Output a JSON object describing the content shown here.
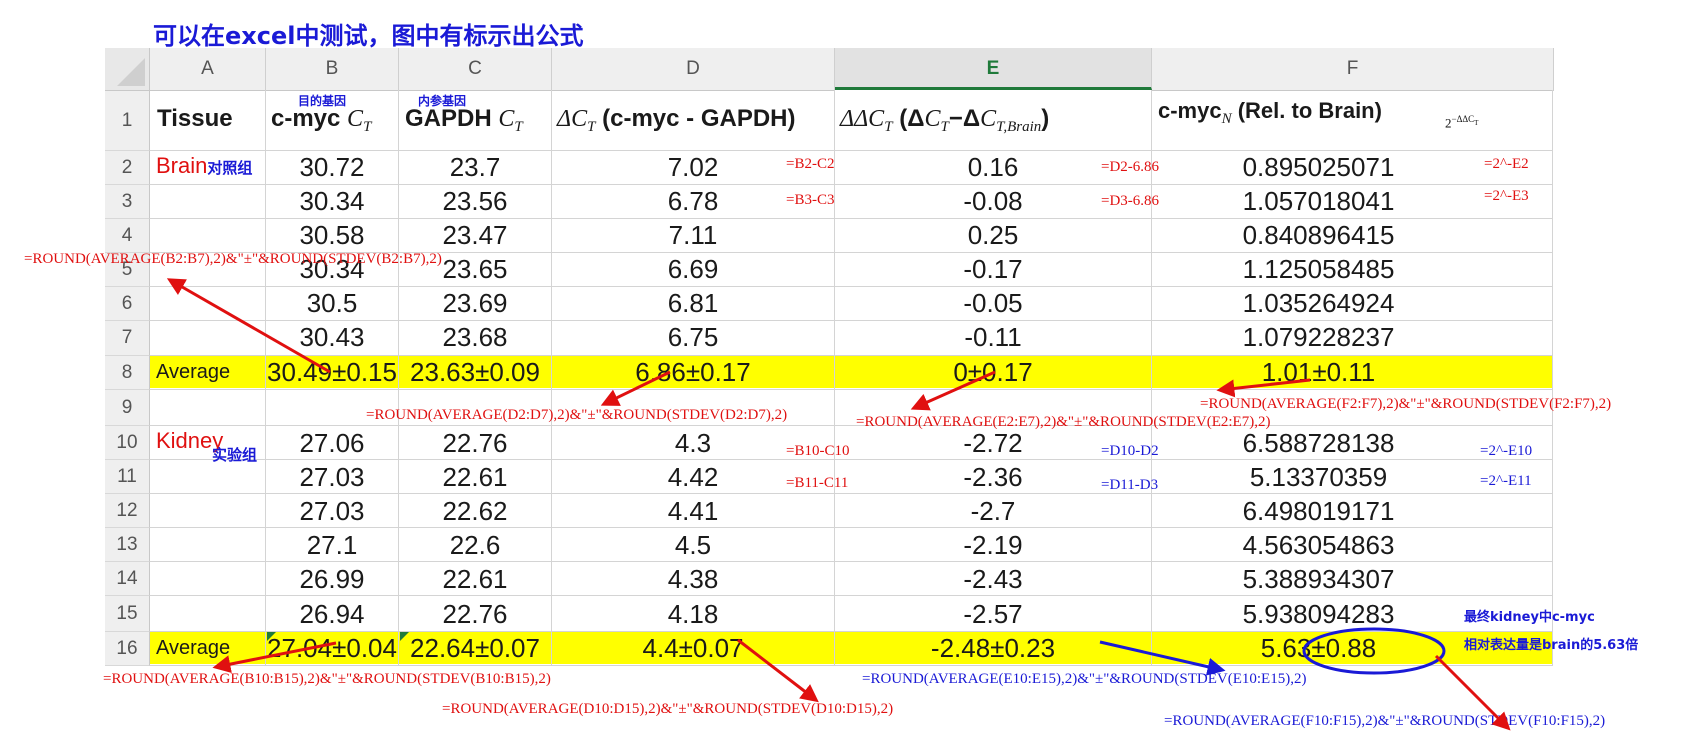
{
  "title": "可以在excel中测试，图中有标示出公式",
  "columns": [
    "A",
    "B",
    "C",
    "D",
    "E",
    "F"
  ],
  "active_column": "E",
  "row_numbers": [
    "1",
    "2",
    "3",
    "4",
    "5",
    "6",
    "7",
    "8",
    "9",
    "10",
    "11",
    "12",
    "13",
    "14",
    "15",
    "16"
  ],
  "header_tags": {
    "B": "目的基因",
    "C": "内参基因"
  },
  "headers": {
    "A": "Tissue",
    "B_pre": "c-myc ",
    "B_it": "C",
    "B_sub": "T",
    "C_pre": "GAPDH ",
    "C_it": "C",
    "C_sub": "T",
    "D_delta": "Δ",
    "D_it": "C",
    "D_sub": "T",
    "D_post": " (c-myc - GAPDH)",
    "E_delta": "ΔΔ",
    "E_it": "C",
    "E_sub": "T",
    "E_post1": " (Δ",
    "E_it2": "C",
    "E_sub2": "T",
    "E_mid": "−Δ",
    "E_it3": "C",
    "E_sub3": "T,Brain",
    "E_post2": ")",
    "F_pre": "c-myc",
    "F_sub": "N",
    "F_post": " (Rel. to Brain)",
    "F_note": "2",
    "F_note_exp": "−ΔΔC",
    "F_note_sub": "T"
  },
  "group_labels": {
    "brain": "Brain",
    "brain_note": "对照组",
    "kidney": "Kidney",
    "kidney_note": "实验组",
    "average": "Average"
  },
  "brain_rows": [
    {
      "B": "30.72",
      "C": "23.7",
      "D": "7.02",
      "E": "0.16",
      "F": "0.895025071"
    },
    {
      "B": "30.34",
      "C": "23.56",
      "D": "6.78",
      "E": "-0.08",
      "F": "1.057018041"
    },
    {
      "B": "30.58",
      "C": "23.47",
      "D": "7.11",
      "E": "0.25",
      "F": "0.840896415"
    },
    {
      "B": "30.34",
      "C": "23.65",
      "D": "6.69",
      "E": "-0.17",
      "F": "1.125058485"
    },
    {
      "B": "30.5",
      "C": "23.69",
      "D": "6.81",
      "E": "-0.05",
      "F": "1.035264924"
    },
    {
      "B": "30.43",
      "C": "23.68",
      "D": "6.75",
      "E": "-0.11",
      "F": "1.079228237"
    }
  ],
  "brain_average": {
    "B": "30.49±0.15",
    "C": "23.63±0.09",
    "D": "6.86±0.17",
    "E": "0±0.17",
    "F": "1.01±0.11"
  },
  "kidney_rows": [
    {
      "B": "27.06",
      "C": "22.76",
      "D": "4.3",
      "E": "-2.72",
      "F": "6.588728138"
    },
    {
      "B": "27.03",
      "C": "22.61",
      "D": "4.42",
      "E": "-2.36",
      "F": "5.13370359"
    },
    {
      "B": "27.03",
      "C": "22.62",
      "D": "4.41",
      "E": "-2.7",
      "F": "6.498019171"
    },
    {
      "B": "27.1",
      "C": "22.6",
      "D": "4.5",
      "E": "-2.19",
      "F": "4.563054863"
    },
    {
      "B": "26.99",
      "C": "22.61",
      "D": "4.38",
      "E": "-2.43",
      "F": "5.388934307"
    },
    {
      "B": "26.94",
      "C": "22.76",
      "D": "4.18",
      "E": "-2.57",
      "F": "5.938094283"
    }
  ],
  "kidney_average": {
    "B": "27.04±0.04",
    "C": "22.64±0.07",
    "D": "4.4±0.07",
    "E": "-2.48±0.23",
    "F": "5.63±0.88"
  },
  "formulas": {
    "d2": "=B2-C2",
    "d3": "=B3-C3",
    "e2": "=D2-6.86",
    "e3": "=D3-6.86",
    "f2": "=2^-E2",
    "f3": "=2^-E3",
    "avg_b_brain": "=ROUND(AVERAGE(B2:B7),2)&\"±\"&ROUND(STDEV(B2:B7),2)",
    "avg_d_brain": "=ROUND(AVERAGE(D2:D7),2)&\"±\"&ROUND(STDEV(D2:D7),2)",
    "avg_e_brain": "=ROUND(AVERAGE(E2:E7),2)&\"±\"&ROUND(STDEV(E2:E7),2)",
    "avg_f_brain": "=ROUND(AVERAGE(F2:F7),2)&\"±\"&ROUND(STDEV(F2:F7),2)",
    "d10": "=B10-C10",
    "d11": "=B11-C11",
    "e10": "=D10-D2",
    "e11": "=D11-D3",
    "f10": "=2^-E10",
    "f11": "=2^-E11",
    "avg_b_kidney": "=ROUND(AVERAGE(B10:B15),2)&\"±\"&ROUND(STDEV(B10:B15),2)",
    "avg_d_kidney": "=ROUND(AVERAGE(D10:D15),2)&\"±\"&ROUND(STDEV(D10:D15),2)",
    "avg_e_kidney": "=ROUND(AVERAGE(E10:E15),2)&\"±\"&ROUND(STDEV(E10:E15),2)",
    "avg_f_kidney": "=ROUND(AVERAGE(F10:F15),2)&\"±\"&ROUND(STDEV(F10:F15),2)"
  },
  "conclusion": {
    "line1": "最终kidney中c-myc",
    "line2": "相对表达量是brain的5.63倍"
  },
  "colors": {
    "highlight": "#ffff00",
    "annotation_red": "#e01010",
    "annotation_blue": "#1a1ad6",
    "active_header": "#1f7a3a"
  }
}
